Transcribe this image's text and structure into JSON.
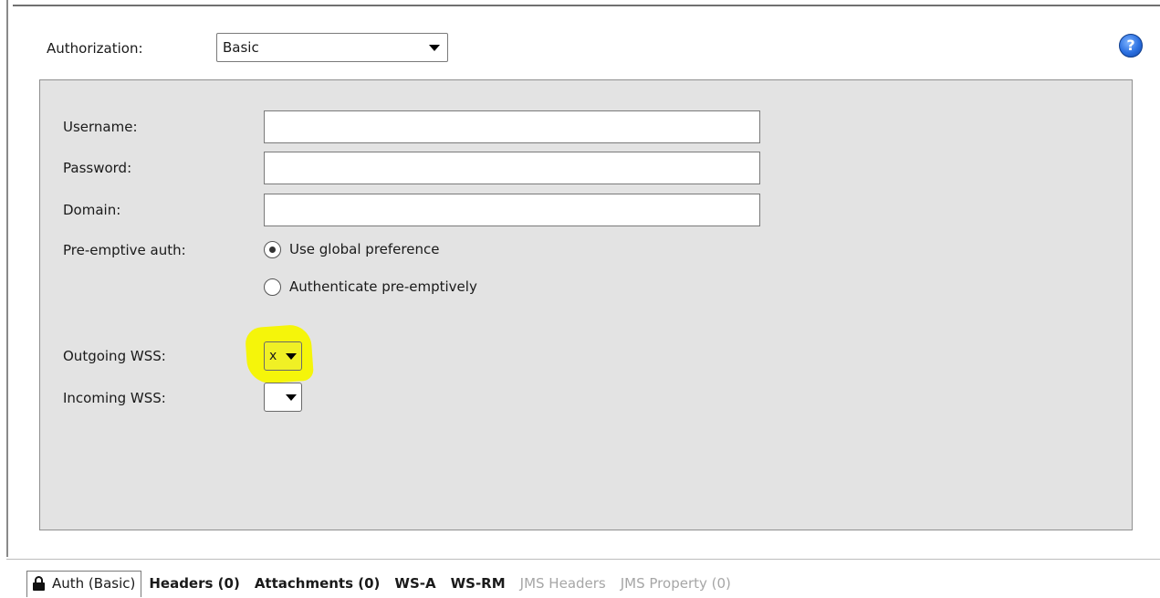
{
  "authorization": {
    "label": "Authorization:",
    "selected": "Basic"
  },
  "help_icon": "question-mark",
  "form": {
    "username_label": "Username:",
    "username_value": "",
    "password_label": "Password:",
    "password_value": "",
    "domain_label": "Domain:",
    "domain_value": "",
    "preemptive_label": "Pre-emptive auth:",
    "preemptive_options": [
      {
        "label": "Use global preference",
        "checked": true
      },
      {
        "label": "Authenticate pre-emptively",
        "checked": false
      }
    ],
    "outgoing_wss_label": "Outgoing WSS:",
    "outgoing_wss_value": "x",
    "incoming_wss_label": "Incoming WSS:",
    "incoming_wss_value": ""
  },
  "highlight_color": "#f5f50a",
  "tabs": [
    {
      "label": "Auth (Basic)",
      "active": true,
      "enabled": true,
      "icon": "lock-icon"
    },
    {
      "label": "Headers (0)",
      "active": false,
      "enabled": true
    },
    {
      "label": "Attachments (0)",
      "active": false,
      "enabled": true
    },
    {
      "label": "WS-A",
      "active": false,
      "enabled": true
    },
    {
      "label": "WS-RM",
      "active": false,
      "enabled": true
    },
    {
      "label": "JMS Headers",
      "active": false,
      "enabled": false
    },
    {
      "label": "JMS Property (0)",
      "active": false,
      "enabled": false
    }
  ]
}
